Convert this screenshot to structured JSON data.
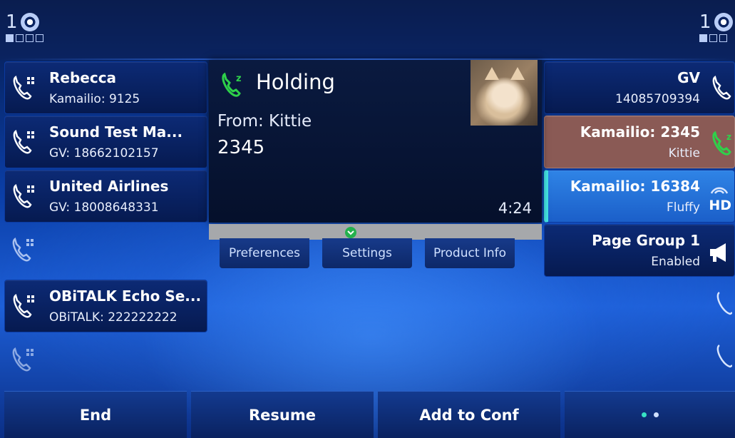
{
  "status": {
    "left_line_number": "1",
    "right_line_number": "1"
  },
  "left_keys": [
    {
      "name": "Rebecca",
      "sub": "Kamailio: 9125"
    },
    {
      "name": "Sound Test Ma...",
      "sub": "GV: 18662102157"
    },
    {
      "name": "United Airlines",
      "sub": "GV: 18008648331"
    },
    {
      "name": "",
      "sub": ""
    },
    {
      "name": "OBiTALK Echo Se...",
      "sub": "OBiTALK: 222222222"
    },
    {
      "name": "",
      "sub": ""
    }
  ],
  "right_keys": [
    {
      "name": "GV",
      "sub": "14085709394"
    },
    {
      "name": "Kamailio: 2345",
      "sub": "Kittie"
    },
    {
      "name": "Kamailio: 16384",
      "sub": "Fluffy"
    },
    {
      "name": "Page Group 1",
      "sub": "Enabled"
    }
  ],
  "call_popup": {
    "state": "Holding",
    "from": "From: Kittie",
    "number": "2345",
    "timer": "4:24"
  },
  "menu": {
    "preferences": "Preferences",
    "settings": "Settings",
    "product_info": "Product Info"
  },
  "softkeys": {
    "end": "End",
    "resume": "Resume",
    "add_to_conf": "Add to Conf"
  },
  "colors": {
    "accent_green": "#2ed14a",
    "active_line": "#44e6e6",
    "highlight_call": "#8a5a55"
  }
}
